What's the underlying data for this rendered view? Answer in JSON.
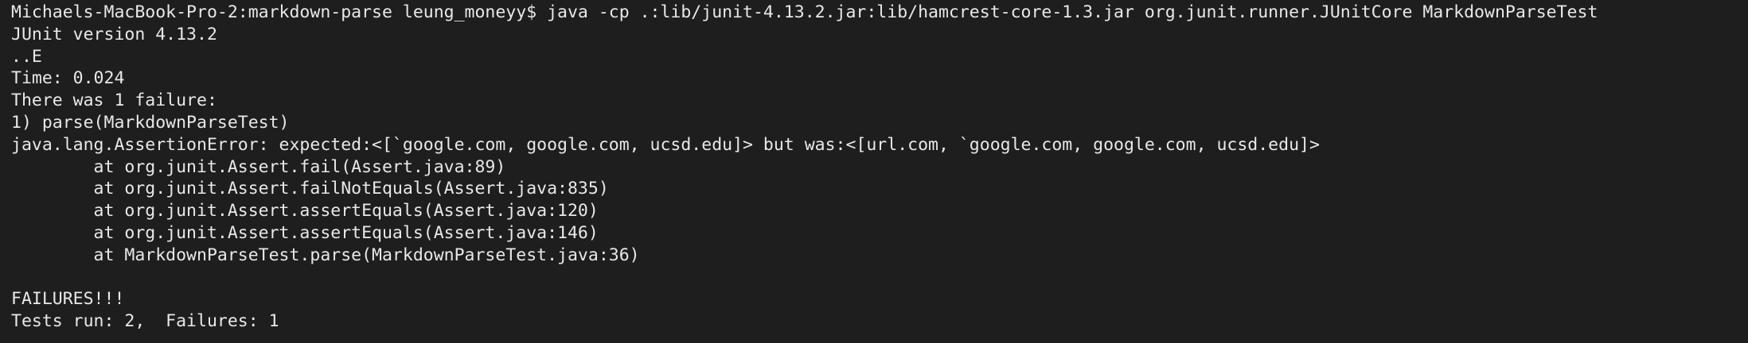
{
  "terminal": {
    "prompt": "Michaels-MacBook-Pro-2:markdown-parse leung_moneyy$ ",
    "command": "java -cp .:lib/junit-4.13.2.jar:lib/hamcrest-core-1.3.jar org.junit.runner.JUnitCore MarkdownParseTest",
    "output": [
      "JUnit version 4.13.2",
      "..E",
      "Time: 0.024",
      "There was 1 failure:",
      "1) parse(MarkdownParseTest)",
      "java.lang.AssertionError: expected:<[`google.com, google.com, ucsd.edu]> but was:<[url.com, `google.com, google.com, ucsd.edu]>",
      "        at org.junit.Assert.fail(Assert.java:89)",
      "        at org.junit.Assert.failNotEquals(Assert.java:835)",
      "        at org.junit.Assert.assertEquals(Assert.java:120)",
      "        at org.junit.Assert.assertEquals(Assert.java:146)",
      "        at MarkdownParseTest.parse(MarkdownParseTest.java:36)",
      "",
      "FAILURES!!!",
      "Tests run: 2,  Failures: 1"
    ]
  },
  "colors": {
    "background": "#1e1e1e",
    "text": "#e8e8e8"
  }
}
